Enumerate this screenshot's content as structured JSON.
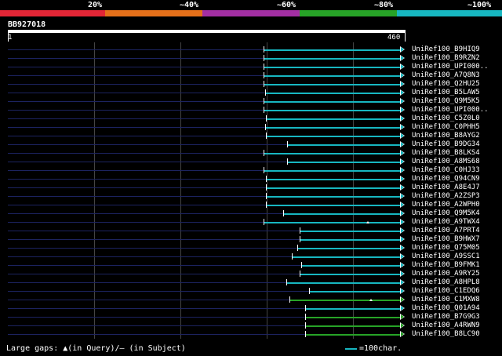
{
  "colors": {
    "band20": "#e32636",
    "band40": "#e5701a",
    "band60": "#a32fa3",
    "band80": "#27a327",
    "band100": "#17b7c1",
    "ghost": "#1c2360"
  },
  "legend": {
    "bands": [
      "20%",
      "~40%",
      "~60%",
      "~80%",
      "~100%"
    ]
  },
  "query": {
    "id": "BB927018",
    "start": "1",
    "end": "460"
  },
  "hits": [
    {
      "name": "UniRef100_B9HIQ9",
      "color_key": "band100"
    },
    {
      "name": "UniRef100_B9RZN2",
      "color_key": "band100"
    },
    {
      "name": "UniRef100_UPI000..",
      "color_key": "band100"
    },
    {
      "name": "UniRef100_A7Q8N3",
      "color_key": "band100"
    },
    {
      "name": "UniRef100_Q2HU25",
      "color_key": "band100"
    },
    {
      "name": "UniRef100_B5LAW5",
      "color_key": "band100"
    },
    {
      "name": "UniRef100_Q9M5K5",
      "color_key": "band100"
    },
    {
      "name": "UniRef100_UPI000..",
      "color_key": "band100"
    },
    {
      "name": "UniRef100_C5Z0L0",
      "color_key": "band100"
    },
    {
      "name": "UniRef100_C0PHH5",
      "color_key": "band100"
    },
    {
      "name": "UniRef100_B8AYG2",
      "color_key": "band100"
    },
    {
      "name": "UniRef100_B9DG34",
      "color_key": "band100"
    },
    {
      "name": "UniRef100_B8LKS4",
      "color_key": "band100"
    },
    {
      "name": "UniRef100_A8MS68",
      "color_key": "band100"
    },
    {
      "name": "UniRef100_C0HJ33",
      "color_key": "band100"
    },
    {
      "name": "UniRef100_Q94CN9",
      "color_key": "band100"
    },
    {
      "name": "UniRef100_A8E4J7",
      "color_key": "band100"
    },
    {
      "name": "UniRef100_A2ZSP3",
      "color_key": "band100"
    },
    {
      "name": "UniRef100_A2WPH0",
      "color_key": "band100"
    },
    {
      "name": "UniRef100_Q9M5K4",
      "color_key": "band100"
    },
    {
      "name": "UniRef100_A9TWX4",
      "color_key": "band100"
    },
    {
      "name": "UniRef100_A7PRT4",
      "color_key": "band100"
    },
    {
      "name": "UniRef100_B9HWX7",
      "color_key": "band100"
    },
    {
      "name": "UniRef100_Q75M05",
      "color_key": "band100"
    },
    {
      "name": "UniRef100_A9SSC1",
      "color_key": "band100"
    },
    {
      "name": "UniRef100_B9FMK1",
      "color_key": "band100"
    },
    {
      "name": "UniRef100_A9RY25",
      "color_key": "band100"
    },
    {
      "name": "UniRef100_A8HPL8",
      "color_key": "band100"
    },
    {
      "name": "UniRef100_C1EDQ6",
      "color_key": "band100"
    },
    {
      "name": "UniRef100_C1MXW8",
      "color_key": "band80"
    },
    {
      "name": "UniRef100_Q01A94",
      "color_key": "band100"
    },
    {
      "name": "UniRef100_B7G9G3",
      "color_key": "band80"
    },
    {
      "name": "UniRef100_A4RWN9",
      "color_key": "band80"
    },
    {
      "name": "UniRef100_B8LC90",
      "color_key": "band80"
    }
  ],
  "footer": {
    "gaps_text": "Large gaps: ▲(in Query)/– (in Subject)",
    "scale_text": "=100char."
  }
}
